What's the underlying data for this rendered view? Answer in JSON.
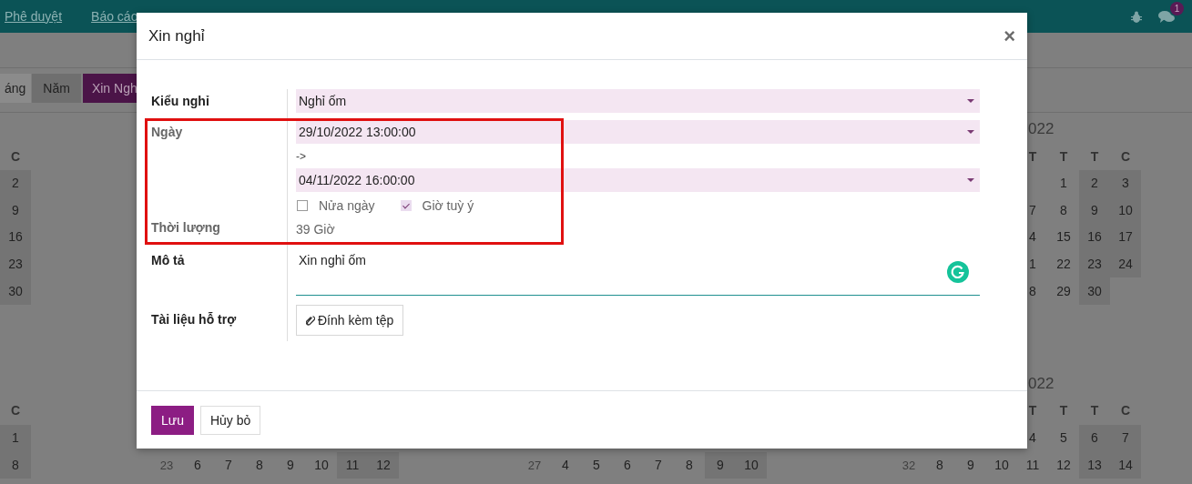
{
  "navbar": {
    "menu": [
      {
        "label": "Phê duyệt"
      },
      {
        "label": "Báo cáo"
      }
    ],
    "messages_badge": "1"
  },
  "view_switch": [
    {
      "label": "áng",
      "selected": false
    },
    {
      "label": "Năm",
      "selected": true
    }
  ],
  "create_button": "Xin Ngh",
  "calendar_bands": [
    {
      "months": [
        {
          "headers": [
            "C"
          ],
          "weeks": [
            [
              "2"
            ],
            [
              "9"
            ],
            [
              "16"
            ],
            [
              "23"
            ],
            [
              "30"
            ]
          ]
        },
        {
          "title": "022",
          "headers": [
            "T",
            "T",
            "T",
            "C"
          ],
          "weeks": [
            [
              "1",
              "2",
              "3"
            ],
            [
              "7",
              "8",
              "9",
              "10"
            ],
            [
              "4",
              "15",
              "16",
              "17"
            ],
            [
              "1",
              "22",
              "23",
              "24"
            ],
            [
              "8",
              "29",
              "30"
            ]
          ]
        }
      ]
    },
    {
      "months": [
        {
          "headers": [
            "C"
          ],
          "weeks": [
            [
              "1"
            ],
            [
              "8"
            ]
          ]
        },
        {
          "weeks": [
            [
              "23",
              "6",
              "7",
              "8",
              "9",
              "10",
              "11",
              "12"
            ]
          ]
        },
        {
          "weeks": [
            [
              "27",
              "4",
              "5",
              "6",
              "7",
              "8",
              "9",
              "10"
            ]
          ]
        },
        {
          "title": "022",
          "headers": [
            "T",
            "T",
            "T",
            "C"
          ],
          "weeks": [
            [
              "4",
              "5",
              "6",
              "7"
            ],
            [
              "32",
              "8",
              "9",
              "10",
              "11",
              "12",
              "13",
              "14"
            ]
          ]
        }
      ]
    }
  ],
  "dialog": {
    "title": "Xin nghỉ",
    "close": "×",
    "fields": [
      {
        "kind": "select",
        "label": "Kiểu nghỉ",
        "muted": false,
        "value": "Nghỉ ốm"
      },
      {
        "kind": "daterange",
        "label": "Ngày",
        "muted": true,
        "start": "29/10/2022 13:00:00",
        "separator": "->",
        "end": "04/11/2022 16:00:00",
        "options": [
          {
            "label": "Nửa ngày",
            "checked": false
          },
          {
            "label": "Giờ tuỳ ý",
            "checked": true
          }
        ]
      },
      {
        "kind": "readonly",
        "label": "Thời lượng",
        "muted": true,
        "value": "39 Giờ"
      },
      {
        "kind": "textarea",
        "label": "Mô tả",
        "muted": false,
        "value": "Xin nghỉ ốm"
      },
      {
        "kind": "attach",
        "label": "Tài liệu hỗ trợ",
        "muted": false,
        "button": "Đính kèm tệp"
      }
    ],
    "buttons": [
      {
        "label": "Lưu",
        "kind": "primary"
      },
      {
        "label": "Hủy bỏ",
        "kind": "secondary"
      }
    ]
  }
}
